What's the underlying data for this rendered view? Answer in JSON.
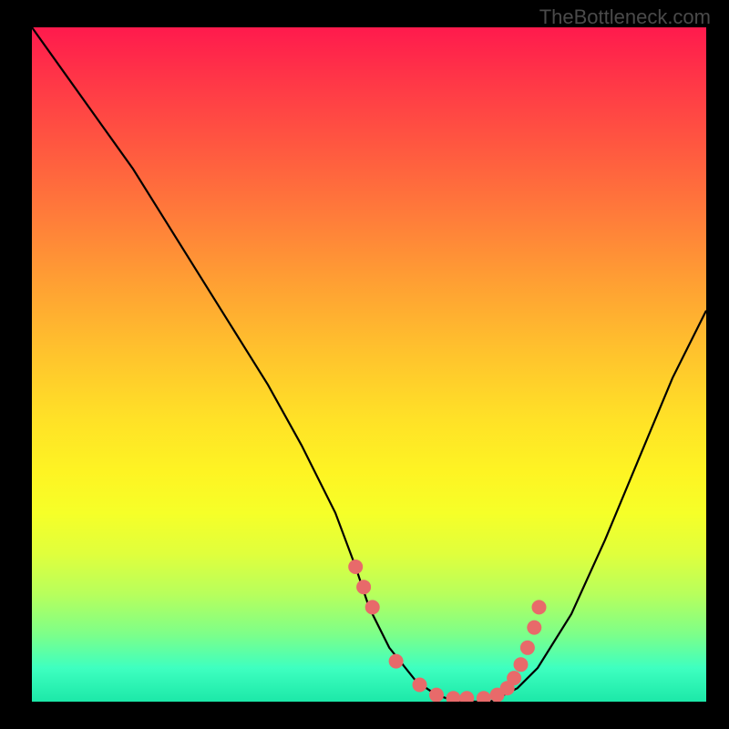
{
  "watermark": "TheBottleneck.com",
  "chart_data": {
    "type": "line",
    "title": "",
    "xlabel": "",
    "ylabel": "",
    "xlim": [
      0,
      100
    ],
    "ylim": [
      0,
      100
    ],
    "series": [
      {
        "name": "bottleneck-curve",
        "x_pct": [
          0,
          5,
          10,
          15,
          20,
          25,
          30,
          35,
          40,
          45,
          48,
          50,
          53,
          57,
          60,
          63,
          66,
          68,
          70,
          72,
          75,
          80,
          85,
          90,
          95,
          100
        ],
        "y_pct": [
          100,
          93,
          86,
          79,
          71,
          63,
          55,
          47,
          38,
          28,
          20,
          14,
          8,
          3,
          1,
          0,
          0,
          0,
          1,
          2,
          5,
          13,
          24,
          36,
          48,
          58
        ]
      }
    ],
    "markers": {
      "name": "highlight-dots",
      "color": "#e86a6a",
      "points_x_pct": [
        48.0,
        49.2,
        50.5,
        54.0,
        57.5,
        60.0,
        62.5,
        64.5,
        67.0,
        69.0,
        70.5,
        71.5,
        72.5,
        73.5,
        74.5,
        75.2
      ],
      "points_y_pct": [
        20.0,
        17.0,
        14.0,
        6.0,
        2.5,
        1.0,
        0.5,
        0.5,
        0.5,
        1.0,
        2.0,
        3.5,
        5.5,
        8.0,
        11.0,
        14.0
      ]
    },
    "background_gradient": {
      "orientation": "vertical",
      "stops": [
        {
          "pct": 0,
          "color": "#ff1a4d"
        },
        {
          "pct": 50,
          "color": "#ffd028"
        },
        {
          "pct": 80,
          "color": "#e8ff3a"
        },
        {
          "pct": 100,
          "color": "#1ce8a8"
        }
      ]
    }
  }
}
